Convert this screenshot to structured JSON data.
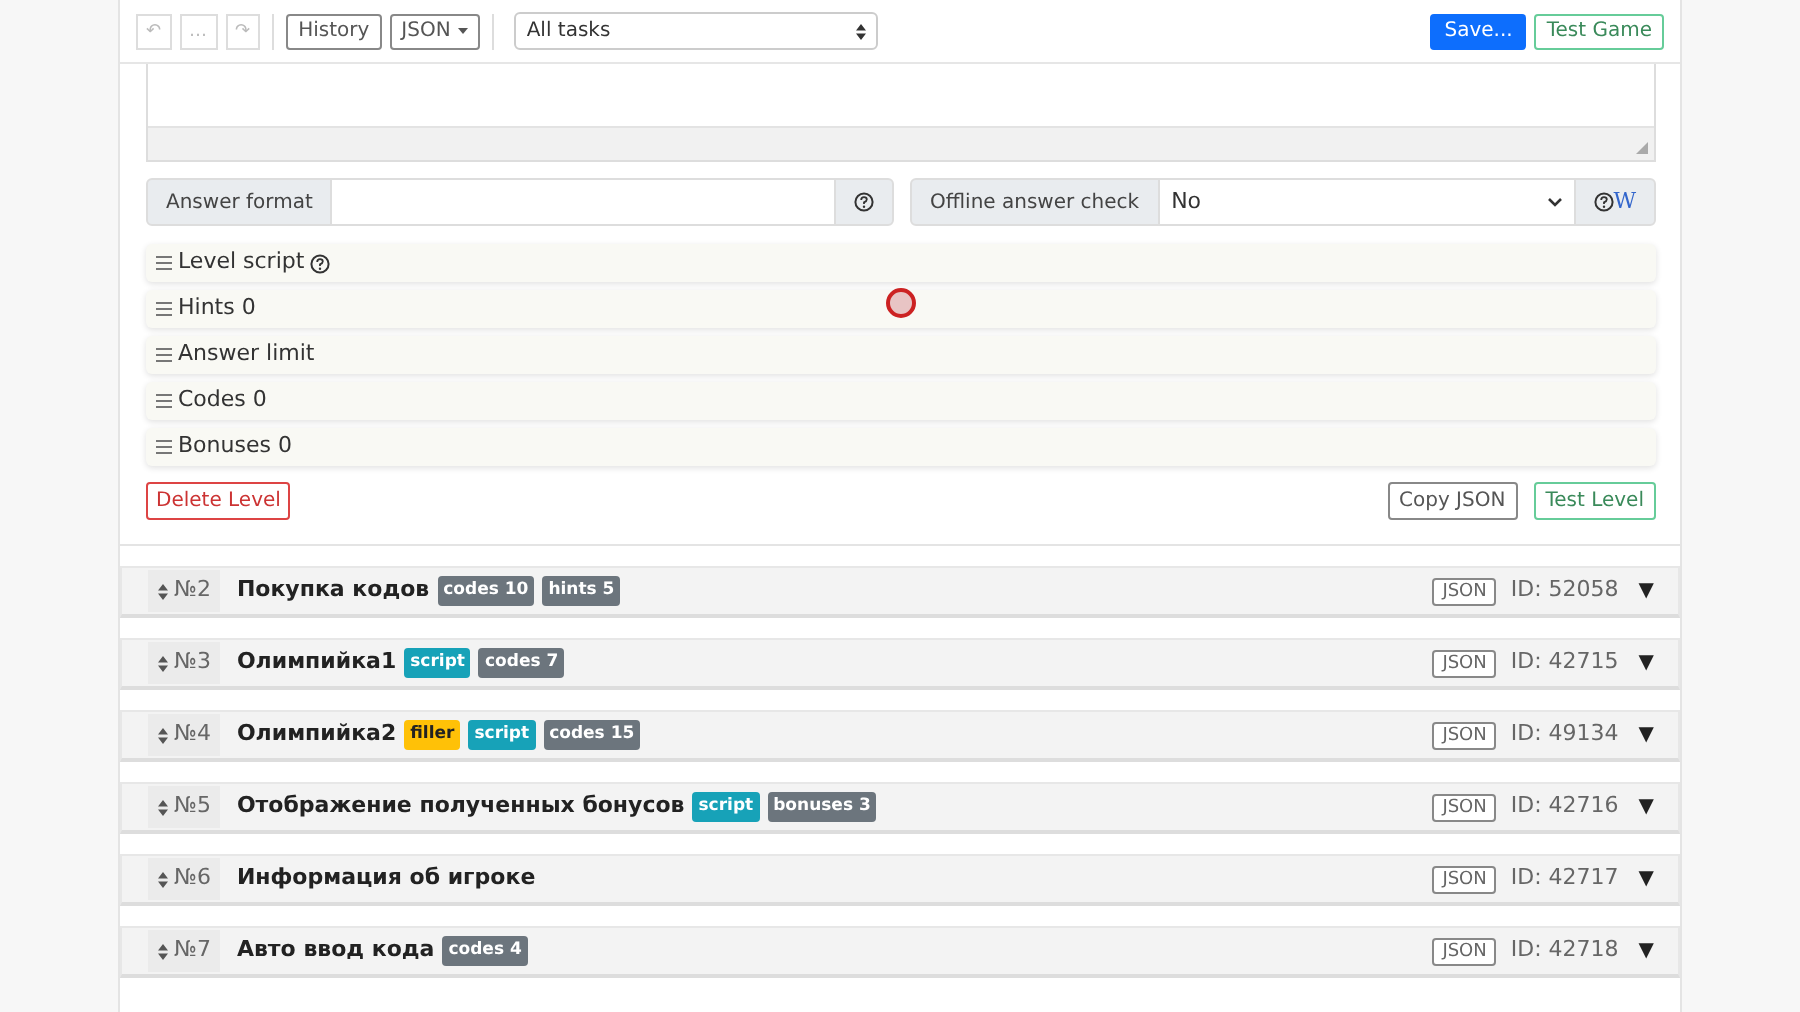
{
  "toolbar": {
    "history_buttons": [
      {
        "label": "↶",
        "disabled": true
      },
      {
        "label": "…",
        "disabled": true
      },
      {
        "label": "↷",
        "disabled": true
      }
    ],
    "history": "History",
    "json_menu": "JSON",
    "task_filter": "All tasks",
    "save": "Save...",
    "test_game": "Test Game"
  },
  "level_editor": {
    "answer_format": {
      "label": "Answer format"
    },
    "offline_check": {
      "label": "Offline answer check",
      "value": "No",
      "wiki": "W"
    },
    "sections": [
      {
        "label": "Level script",
        "help": true
      },
      {
        "label": "Hints 0",
        "help": false
      },
      {
        "label": "Answer limit",
        "help": false
      },
      {
        "label": "Codes 0",
        "help": false
      },
      {
        "label": "Bonuses 0",
        "help": false
      }
    ],
    "delete": "Delete Level",
    "copy_json": "Copy JSON",
    "test_level": "Test Level"
  },
  "levels": [
    {
      "number": "№2",
      "title": "Покупка кодов",
      "tags": [
        {
          "text": "codes 10",
          "color": "#6c757d"
        },
        {
          "text": "hints 5",
          "color": "#6c757d"
        }
      ],
      "json": "JSON",
      "id": "ID: 52058",
      "toggle": "▼"
    },
    {
      "number": "№3",
      "title": "Олимпийка1",
      "tags": [
        {
          "text": "script",
          "color": "#17a2b8"
        },
        {
          "text": "codes 7",
          "color": "#6c757d"
        }
      ],
      "json": "JSON",
      "id": "ID: 42715",
      "toggle": "▼"
    },
    {
      "number": "№4",
      "title": "Олимпийка2",
      "tags": [
        {
          "text": "filler",
          "color": "#ffc107"
        },
        {
          "text": "script",
          "color": "#17a2b8"
        },
        {
          "text": "codes 15",
          "color": "#6c757d"
        }
      ],
      "json": "JSON",
      "id": "ID: 49134",
      "toggle": "▼"
    },
    {
      "number": "№5",
      "title": "Отображение полученных бонусов",
      "tags": [
        {
          "text": "script",
          "color": "#17a2b8"
        },
        {
          "text": "bonuses 3",
          "color": "#6c757d"
        }
      ],
      "json": "JSON",
      "id": "ID: 42716",
      "toggle": "▼"
    },
    {
      "number": "№6",
      "title": "Информация об игроке",
      "json": "JSON",
      "id": "ID: 42717",
      "toggle": "▼"
    },
    {
      "number": "№7",
      "title": "Авто ввод кода",
      "tags": [
        {
          "text": "codes 4",
          "color": "#6c757d"
        }
      ],
      "json": "JSON",
      "id": "ID: 42718",
      "toggle": "▼"
    }
  ]
}
